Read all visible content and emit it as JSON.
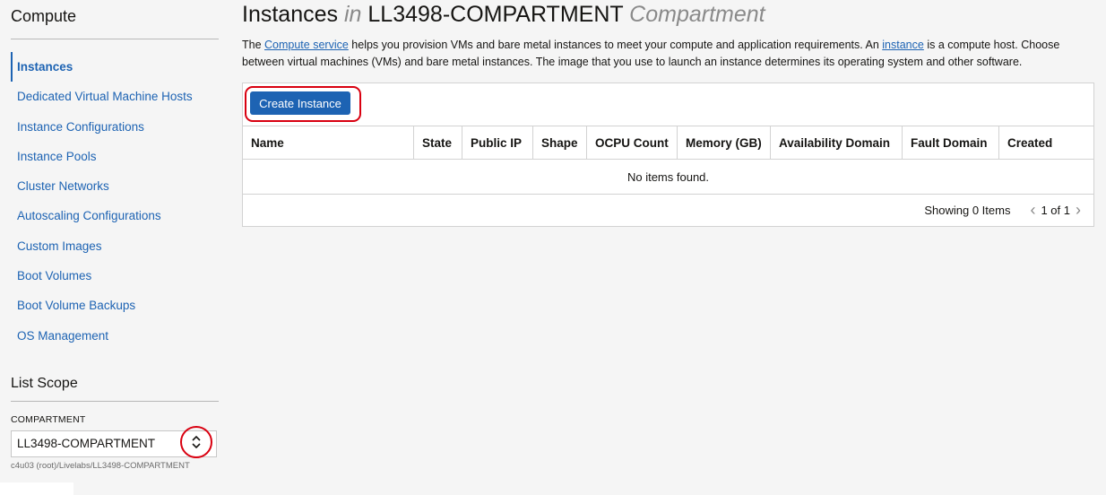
{
  "sidebar": {
    "title": "Compute",
    "items": [
      {
        "label": "Instances",
        "active": true
      },
      {
        "label": "Dedicated Virtual Machine Hosts"
      },
      {
        "label": "Instance Configurations"
      },
      {
        "label": "Instance Pools"
      },
      {
        "label": "Cluster Networks"
      },
      {
        "label": "Autoscaling Configurations"
      },
      {
        "label": "Custom Images"
      },
      {
        "label": "Boot Volumes"
      },
      {
        "label": "Boot Volume Backups"
      },
      {
        "label": "OS Management"
      }
    ],
    "scope": {
      "title": "List Scope",
      "compartment_label": "COMPARTMENT",
      "compartment_value": "LL3498-COMPARTMENT",
      "compartment_path": "c4u03 (root)/Livelabs/LL3498-COMPARTMENT"
    }
  },
  "main": {
    "title_prefix": "Instances",
    "title_in": "in",
    "title_compartment": "LL3498-COMPARTMENT",
    "title_suffix": "Compartment",
    "desc": {
      "p1": "The ",
      "link1": "Compute service",
      "p2": " helps you provision VMs and bare metal instances to meet your compute and application requirements. An ",
      "link2": "instance",
      "p3": " is a compute host. Choose between virtual machines (VMs) and bare metal instances. The image that you use to launch an instance determines its operating system and other software."
    },
    "create_button": "Create Instance",
    "columns": [
      "Name",
      "State",
      "Public IP",
      "Shape",
      "OCPU Count",
      "Memory (GB)",
      "Availability Domain",
      "Fault Domain",
      "Created"
    ],
    "empty_text": "No items found.",
    "pager": {
      "showing": "Showing 0 Items",
      "page": "1 of 1"
    }
  },
  "colors": {
    "accent": "#1d63b3",
    "highlight": "#d90010"
  }
}
